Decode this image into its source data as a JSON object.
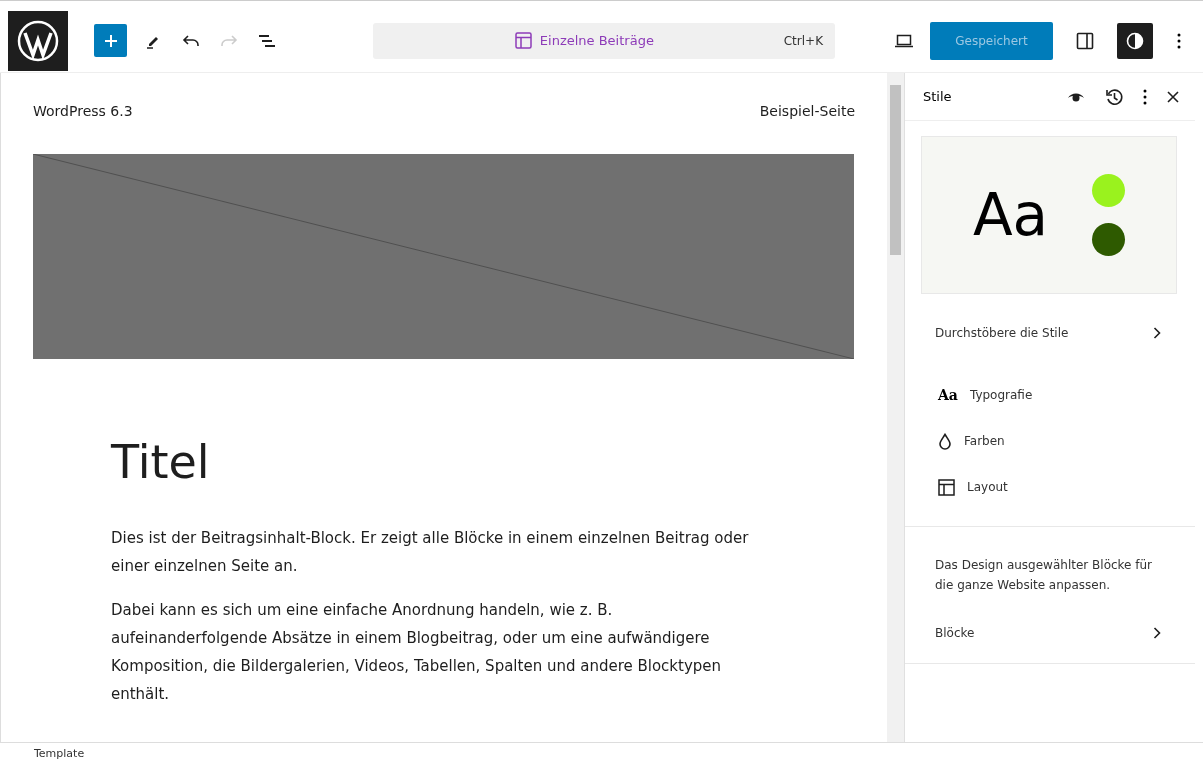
{
  "toolbar": {
    "command": {
      "label": "Einzelne Beiträge",
      "shortcut": "Ctrl+K"
    },
    "undo": {
      "disabled": false
    },
    "redo": {
      "disabled": true
    },
    "save": {
      "label": "Gespeichert"
    },
    "styles_toggle": {
      "selected": true
    }
  },
  "canvas": {
    "site_title": "WordPress 6.3",
    "nav_link": "Beispiel-Seite",
    "post_title": "Titel",
    "paragraphs": [
      "Dies ist der Beitragsinhalt-Block. Er zeigt alle Blöcke in einem einzelnen Beitrag oder einer einzelnen Seite an.",
      "Dabei kann es sich um eine einfache Anordnung handeln, wie z. B. aufeinanderfolgende Absätze in einem Blogbeitrag, oder um eine aufwändigere Komposition, die Bildergalerien, Videos, Tabellen, Spalten und andere Blocktypen enthält."
    ]
  },
  "sidebar": {
    "title": "Stile",
    "preview": {
      "text": "Aa",
      "colors": [
        {
          "color": "#9af21e"
        },
        {
          "color": "#2e5a00"
        }
      ]
    },
    "browse": "Durchstöbere die Stile",
    "items": [
      {
        "kind": "typography",
        "label": "Typografie",
        "glyph": "Aa"
      },
      {
        "kind": "colors",
        "label": "Farben"
      },
      {
        "kind": "layout",
        "label": "Layout"
      }
    ],
    "blocks_hint": "Das Design ausgewählter Blöcke für die ganze Website anpassen.",
    "blocks": "Blöcke"
  },
  "status_bar": {
    "breadcrumb": "Template"
  }
}
